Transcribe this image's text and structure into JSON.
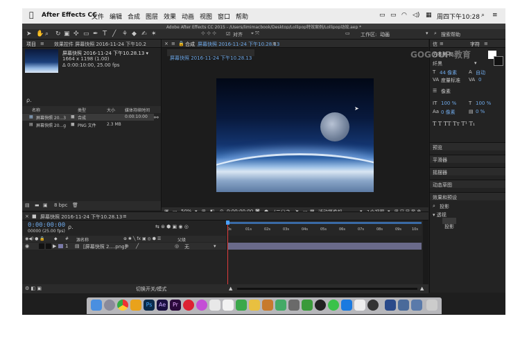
{
  "menubar": {
    "app_name": "After Effects CC",
    "menus": [
      "文件",
      "编辑",
      "合成",
      "图层",
      "效果",
      "动画",
      "视图",
      "窗口",
      "帮助"
    ],
    "clock": "周四下午10:28"
  },
  "window_title": "Adobe After Effects CC 2015 - /Users/limimacbook/Desktop/Lollipop特效案例/Lollipop动效.aep *",
  "toolbar": {
    "align_label": "对齐",
    "workspace_label": "工作区:",
    "workspace_value": "动画",
    "search_help": "搜索帮助"
  },
  "project_panel": {
    "tab_project": "项目",
    "tab_effects": "效果控件 屏幕快照 2016-11-24 下午10.2",
    "preview_name": "屏幕快照 2016-11-24 下午10.28.13 ▾",
    "preview_size": "1664 x 1198 (1.00)",
    "preview_duration": "Δ 0:00:10:00, 25.00 fps",
    "search_placeholder": "ρ.",
    "columns": [
      "名称",
      "类型",
      "大小",
      "媒体持续时间"
    ],
    "rows": [
      {
        "name": "屏幕快照 20...3",
        "type": "合成",
        "size": "",
        "duration": "0:00:10:00"
      },
      {
        "name": "屏幕快照 20...g",
        "type": "PNG 文件",
        "size": "2.3 MB",
        "duration": ""
      }
    ],
    "bpc": "8 bpc"
  },
  "comp_panel": {
    "tab_label": "合成",
    "tab_name": "屏幕快照 2016-11-24 下午10.28.13",
    "sub_tab": "屏幕快照 2016-11-24 下午10.28.13",
    "zoom": "50%",
    "timecode": "0:00:00:00",
    "resolution": "(二分之一)",
    "camera": "活动摄像机",
    "views": "1个视图"
  },
  "timeline": {
    "tab_name": "屏幕快照 2016-11-24 下午10.28.13",
    "current_time": "0:00:00:00",
    "frame_info": "00000 (25.00 fps)",
    "col_source": "源名称",
    "col_parent": "父级",
    "layer_index": "1",
    "layer_name": "[屏幕快照 2....png]",
    "parent_value": "无",
    "footer": "切换开关/模式",
    "ruler": [
      "0s",
      "01s",
      "02s",
      "03s",
      "04s",
      "05s",
      "06s",
      "07s",
      "08s",
      "09s",
      "10s"
    ]
  },
  "right_panels": {
    "tab_info": "信",
    "tab_char": "字符",
    "font_label": "纤黑",
    "font_family": "方季黑-简",
    "font_size": "44 像素",
    "leading": "自动",
    "tracking_label": "度量标准",
    "tracking_value": "0",
    "stroke": "像素",
    "vscale": "100 %",
    "hscale": "100 %",
    "baseline": "0 像素",
    "tsume": "0 %",
    "sections": [
      "预览",
      "平滑器",
      "摇摆器",
      "动态草图",
      "效果和预设"
    ],
    "effects_search": "投影",
    "tree_category": "▾ 透视",
    "tree_item": "投影"
  },
  "watermark": "GOGOUP 教育"
}
